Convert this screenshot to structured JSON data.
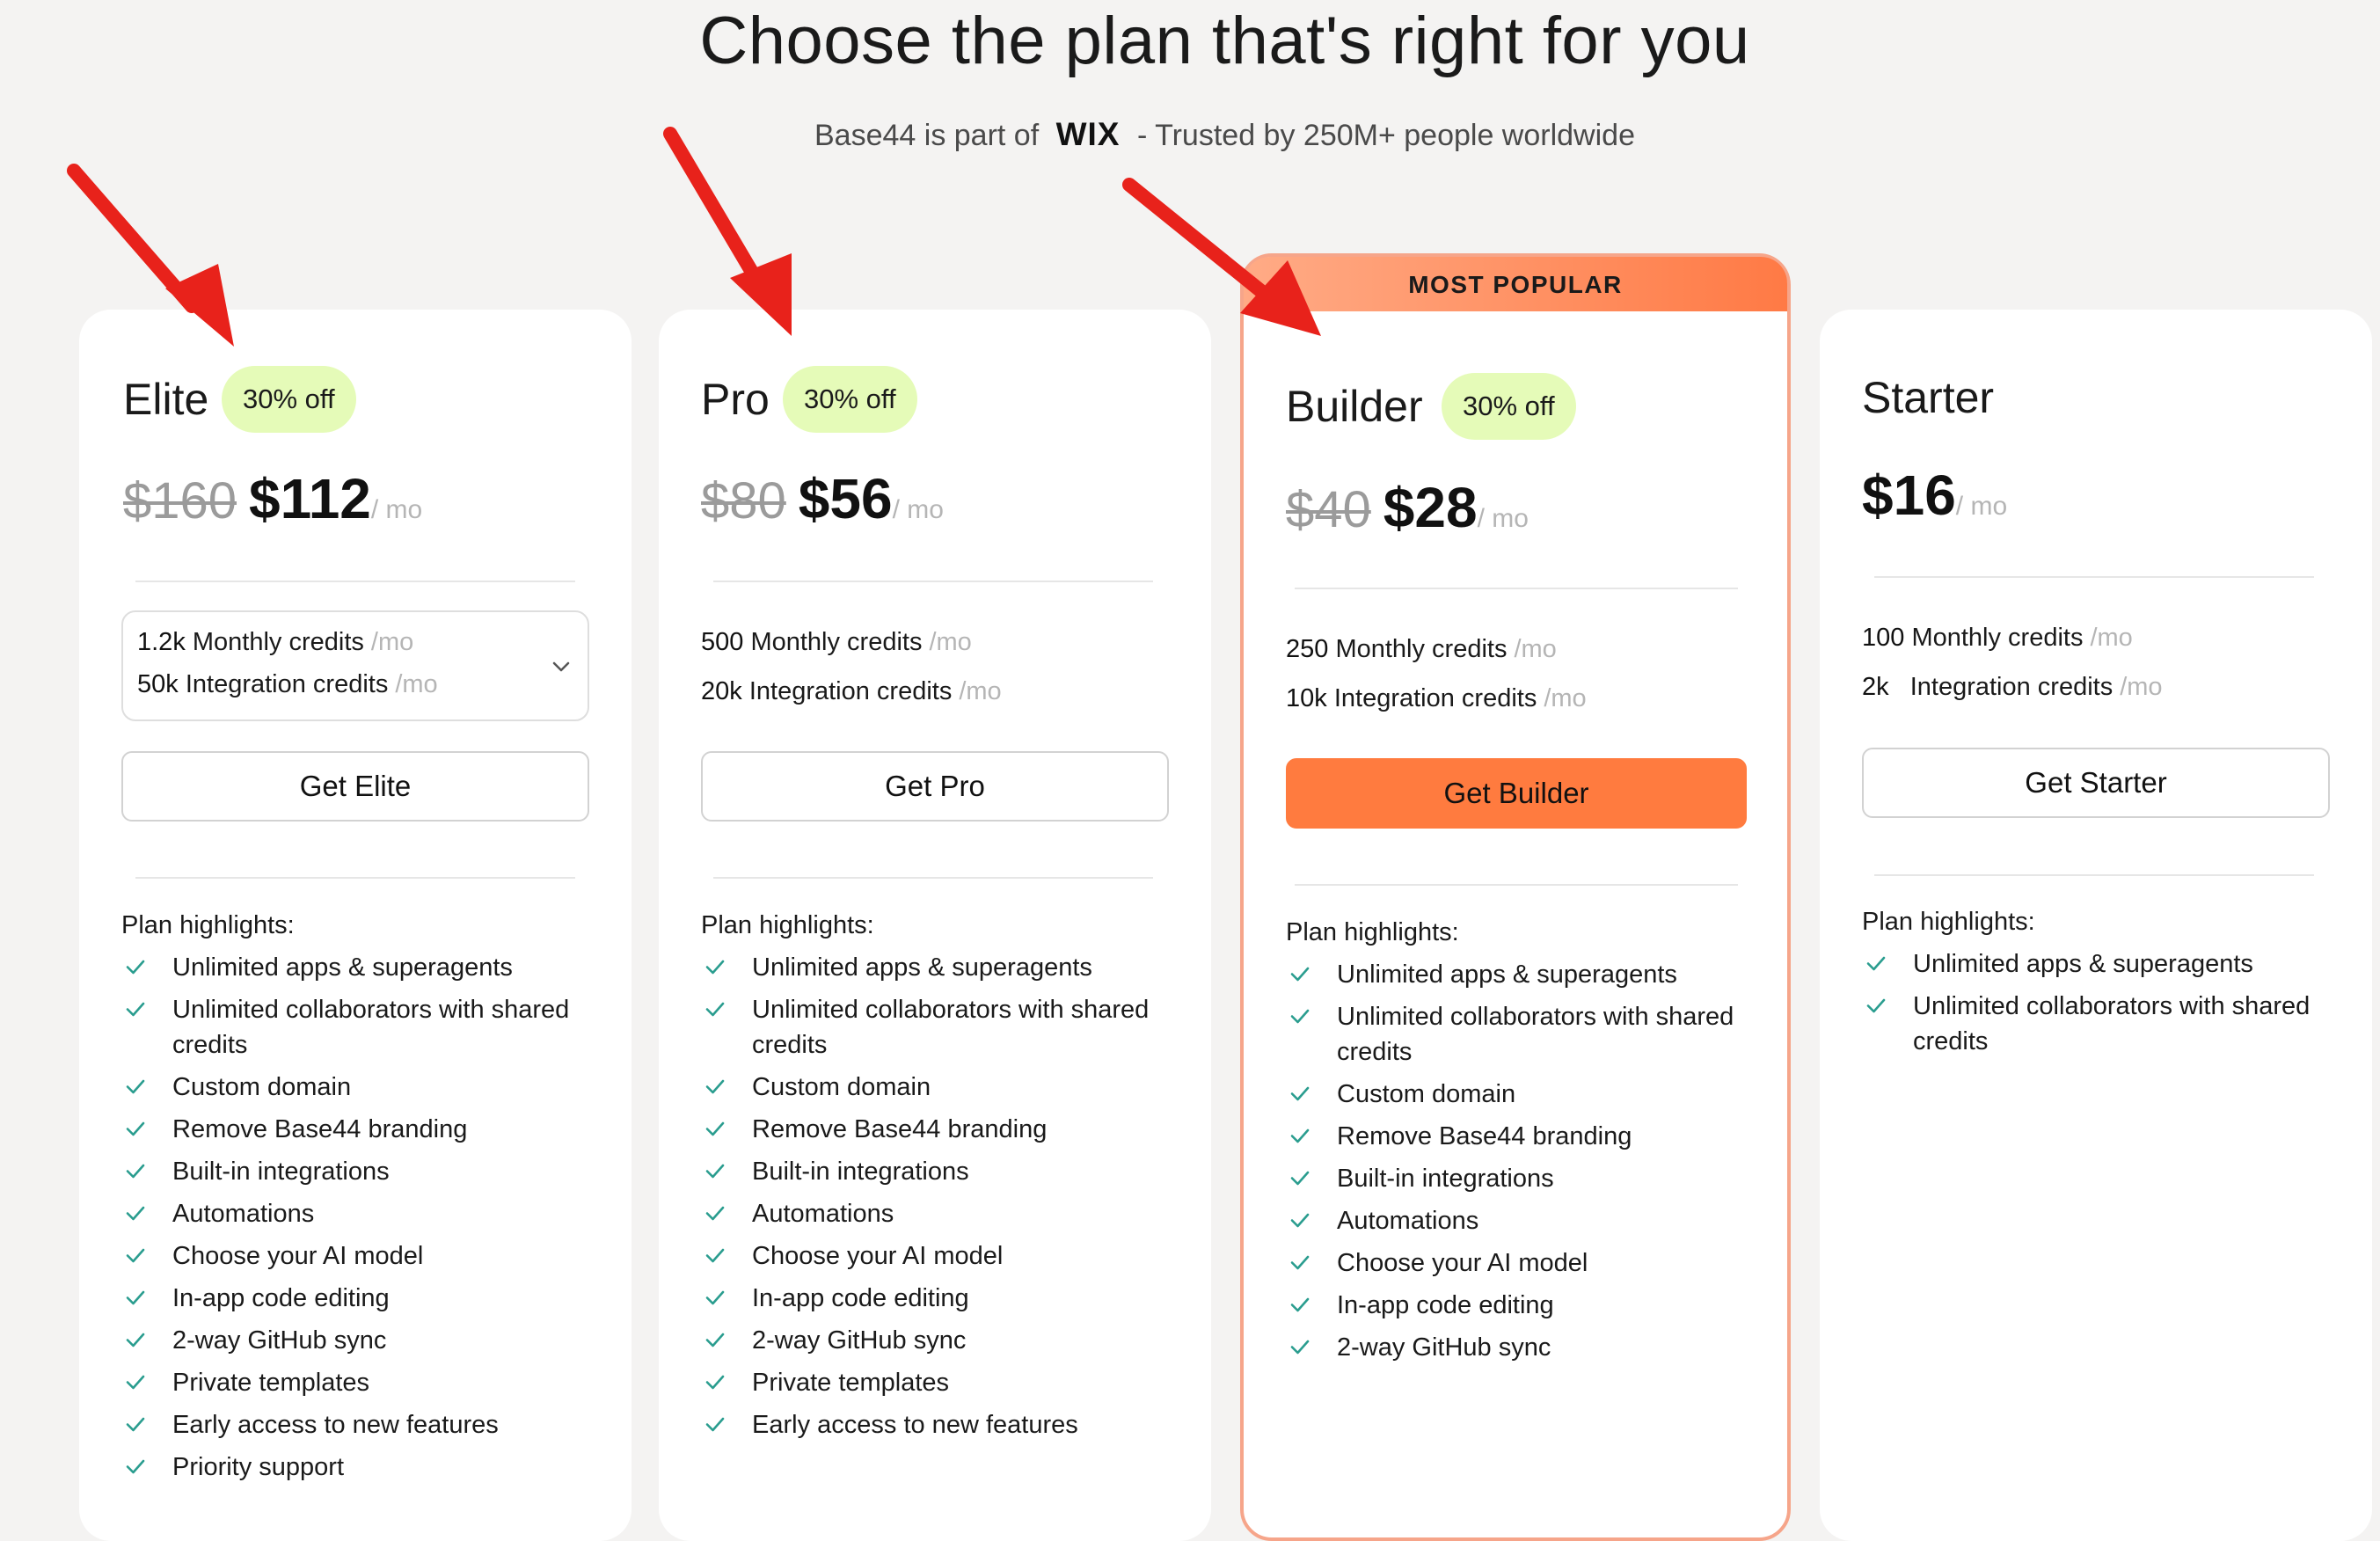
{
  "header": {
    "title": "Choose the plan that's right for you",
    "subtitle_prefix": "Base44 is part of",
    "subtitle_brand": "WIX",
    "subtitle_suffix": "- Trusted by 250M+ people worldwide"
  },
  "colors": {
    "accent": "#ff7b3f",
    "badge_bg": "#e5fbb8",
    "check": "#2a9d8f",
    "annotation_arrow": "#e8221b"
  },
  "popular_label": "MOST POPULAR",
  "plans": [
    {
      "name": "Elite",
      "badge": "30% off",
      "old_price": "$160",
      "price": "$112",
      "per": "/ mo",
      "credits": [
        {
          "amount": "1.2k",
          "label": "Monthly credits",
          "per": "/mo"
        },
        {
          "amount": "50k",
          "label": "Integration credits",
          "per": "/mo"
        }
      ],
      "credits_selector_icon": "chevron-down-icon",
      "cta": "Get Elite",
      "highlights_title": "Plan highlights:",
      "features": [
        "Unlimited apps & superagents",
        "Unlimited collaborators with shared",
        "credits",
        "Custom domain",
        "Remove Base44 branding",
        "Built-in integrations",
        "Automations",
        "Choose your AI model",
        "In-app code editing",
        "2-way GitHub sync",
        "Private templates",
        "Early access to new features",
        "Priority support"
      ]
    },
    {
      "name": "Pro",
      "badge": "30% off",
      "old_price": "$80",
      "price": "$56",
      "per": "/ mo",
      "credits": [
        {
          "amount": "500",
          "label": "Monthly credits",
          "per": "/mo"
        },
        {
          "amount": "20k",
          "label": "Integration credits",
          "per": "/mo"
        }
      ],
      "cta": "Get Pro",
      "highlights_title": "Plan highlights:",
      "features": [
        "Unlimited apps & superagents",
        "Unlimited collaborators with shared",
        "credits",
        "Custom domain",
        "Remove Base44 branding",
        "Built-in integrations",
        "Automations",
        "Choose your AI model",
        "In-app code editing",
        "2-way GitHub sync",
        "Private templates",
        "Early access to new features"
      ]
    },
    {
      "name": "Builder",
      "badge": "30% off",
      "old_price": "$40",
      "price": "$28",
      "per": "/ mo",
      "credits": [
        {
          "amount": "250",
          "label": "Monthly credits",
          "per": "/mo"
        },
        {
          "amount": "10k",
          "label": "Integration credits",
          "per": "/mo"
        }
      ],
      "cta": "Get Builder",
      "highlights_title": "Plan highlights:",
      "features": [
        "Unlimited apps & superagents",
        "Unlimited collaborators with shared",
        "credits",
        "Custom domain",
        "Remove Base44 branding",
        "Built-in integrations",
        "Automations",
        "Choose your AI model",
        "In-app code editing",
        "2-way GitHub sync"
      ]
    },
    {
      "name": "Starter",
      "price": "$16",
      "per": "/ mo",
      "credits": [
        {
          "amount": "100",
          "label": "Monthly credits",
          "per": "/mo"
        },
        {
          "amount": "2k",
          "label": "Integration credits",
          "per": "/mo"
        }
      ],
      "cta": "Get Starter",
      "highlights_title": "Plan highlights:",
      "features": [
        "Unlimited apps & superagents",
        "Unlimited collaborators with shared",
        "credits"
      ]
    }
  ]
}
